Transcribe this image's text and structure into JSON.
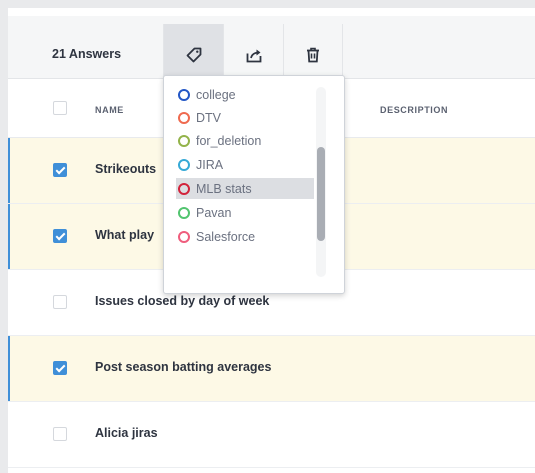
{
  "toolbar": {
    "answer_count": "21 Answers",
    "buttons": [
      {
        "icon": "tag-icon",
        "active": true
      },
      {
        "icon": "share-icon",
        "active": false
      },
      {
        "icon": "trash-icon",
        "active": false
      }
    ]
  },
  "table": {
    "columns": [
      "NAME",
      "DESCRIPTION"
    ],
    "rows": [
      {
        "name": "Strikeouts",
        "checked": true
      },
      {
        "name": "What play",
        "checked": true
      },
      {
        "name": "Issues closed by day of week",
        "checked": false
      },
      {
        "name": "Post season batting averages",
        "checked": true
      },
      {
        "name": "Alicia jiras",
        "checked": false
      }
    ]
  },
  "tag_menu": {
    "items": [
      {
        "label": "college",
        "color": "#2357c6"
      },
      {
        "label": "DTV",
        "color": "#ef6a4f"
      },
      {
        "label": "for_deletion",
        "color": "#93b34a"
      },
      {
        "label": "JIRA",
        "color": "#36a9d6"
      },
      {
        "label": "MLB stats",
        "color": "#d2233b",
        "hovered": true
      },
      {
        "label": "Pavan",
        "color": "#52c46f"
      },
      {
        "label": "Salesforce",
        "color": "#ef5d7d"
      }
    ]
  },
  "colors": {
    "accent": "#3f8fd8",
    "selected_row": "#fdf9e6"
  }
}
